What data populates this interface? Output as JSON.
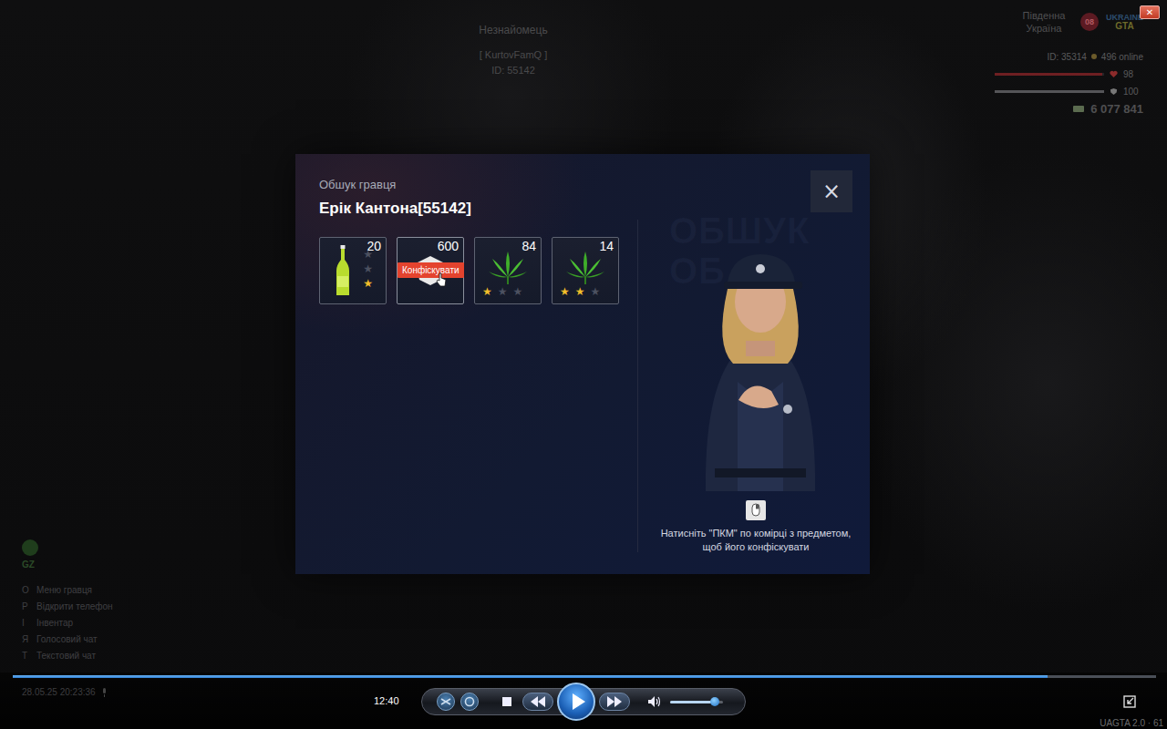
{
  "player_tag": {
    "name": "Незнайомець",
    "family": "[ KurtovFamQ ]",
    "id": "ID: 55142"
  },
  "server": {
    "region": "Південна Україна",
    "region_badge": "08",
    "logo": [
      "UKRAINE",
      "GTA"
    ],
    "id": "ID: 35314",
    "online": "496 online",
    "health": {
      "value": "98",
      "level": 0.98
    },
    "armor": {
      "value": "100",
      "level": 1
    },
    "money": "6 077 841"
  },
  "modal": {
    "subtitle": "Обшук гравця",
    "title": "Ерік Кантона[55142]",
    "close": "×",
    "watermark": [
      "ОБШУК",
      "ОБ"
    ],
    "hint": "Натисніть \"ПКМ\" по комірці з предметом, щоб його конфіскувати",
    "items": [
      {
        "kind": "bottle",
        "count": "20",
        "stars": 1,
        "max_stars": 3,
        "hovered": false,
        "tooltip": ""
      },
      {
        "kind": "money",
        "count": "600",
        "stars": 0,
        "max_stars": 0,
        "hovered": true,
        "tooltip": "Конфіскувати"
      },
      {
        "kind": "weed",
        "count": "84",
        "stars": 1,
        "max_stars": 3,
        "hovered": false,
        "tooltip": ""
      },
      {
        "kind": "weed",
        "count": "14",
        "stars": 2,
        "max_stars": 3,
        "hovered": false,
        "tooltip": ""
      }
    ]
  },
  "hud": {
    "zone": "GZ",
    "hints": [
      {
        "key": "O",
        "label": "Меню гравця"
      },
      {
        "key": "P",
        "label": "Відкрити телефон"
      },
      {
        "key": "I",
        "label": "Інвентар"
      },
      {
        "key": "Я",
        "label": "Голосовий чат"
      },
      {
        "key": "T",
        "label": "Текстовий чат"
      }
    ],
    "datetime": "28.05.25 20:23:36",
    "version": "UAGTA 2.0 · 61"
  },
  "media_player": {
    "time": "12:40",
    "progress": 0.905,
    "volume": 0.85,
    "close": "✕"
  }
}
